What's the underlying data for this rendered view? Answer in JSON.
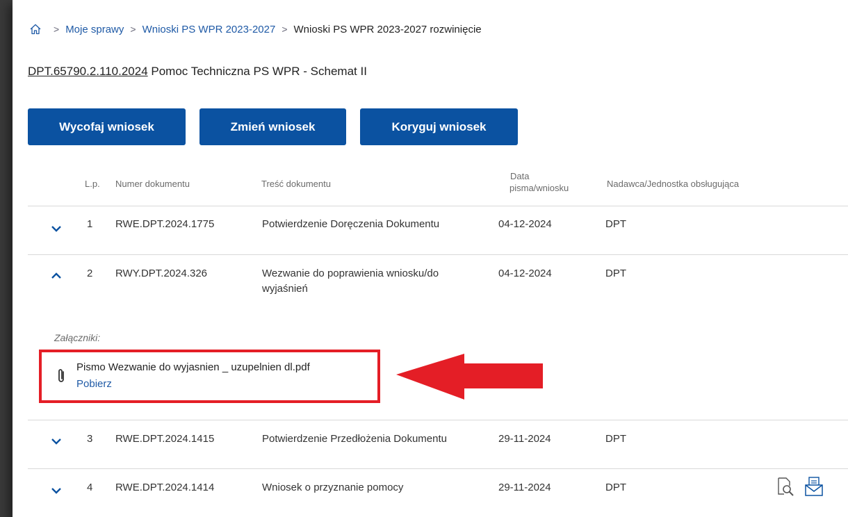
{
  "breadcrumb": {
    "items": [
      "Moje sprawy",
      "Wnioski PS WPR 2023-2027"
    ],
    "current": "Wnioski PS WPR 2023-2027 rozwinięcie",
    "separator": ">"
  },
  "case": {
    "number": "DPT.65790.2.110.2024",
    "title": "Pomoc Techniczna PS WPR - Schemat II"
  },
  "actions": {
    "withdraw": "Wycofaj wniosek",
    "change": "Zmień wniosek",
    "correct": "Koryguj wniosek"
  },
  "table": {
    "headers": {
      "lp": "L.p.",
      "number": "Numer dokumentu",
      "content": "Treść dokumentu",
      "date_line1": "Data",
      "date_line2": "pisma/wniosku",
      "sender": "Nadawca/Jednostka obsługująca"
    },
    "rows": [
      {
        "lp": "1",
        "number": "RWE.DPT.2024.1775",
        "content": "Potwierdzenie Doręczenia Dokumentu",
        "date": "04-12-2024",
        "sender": "DPT"
      },
      {
        "lp": "2",
        "number": "RWY.DPT.2024.326",
        "content_line1": "Wezwanie do poprawienia wniosku/do",
        "content_line2": "wyjaśnień",
        "date": "04-12-2024",
        "sender": "DPT"
      },
      {
        "lp": "3",
        "number": "RWE.DPT.2024.1415",
        "content": "Potwierdzenie Przedłożenia Dokumentu",
        "date": "29-11-2024",
        "sender": "DPT"
      },
      {
        "lp": "4",
        "number": "RWE.DPT.2024.1414",
        "content": "Wniosek o przyznanie pomocy",
        "date": "29-11-2024",
        "sender": "DPT"
      }
    ]
  },
  "attachments": {
    "label": "Załączniki:",
    "file_name": "Pismo Wezwanie do wyjasnien _ uzupelnien dl.pdf",
    "download": "Pobierz"
  },
  "colors": {
    "primary": "#0b52a1",
    "link": "#1f5aa6",
    "highlight": "#e41e26"
  }
}
